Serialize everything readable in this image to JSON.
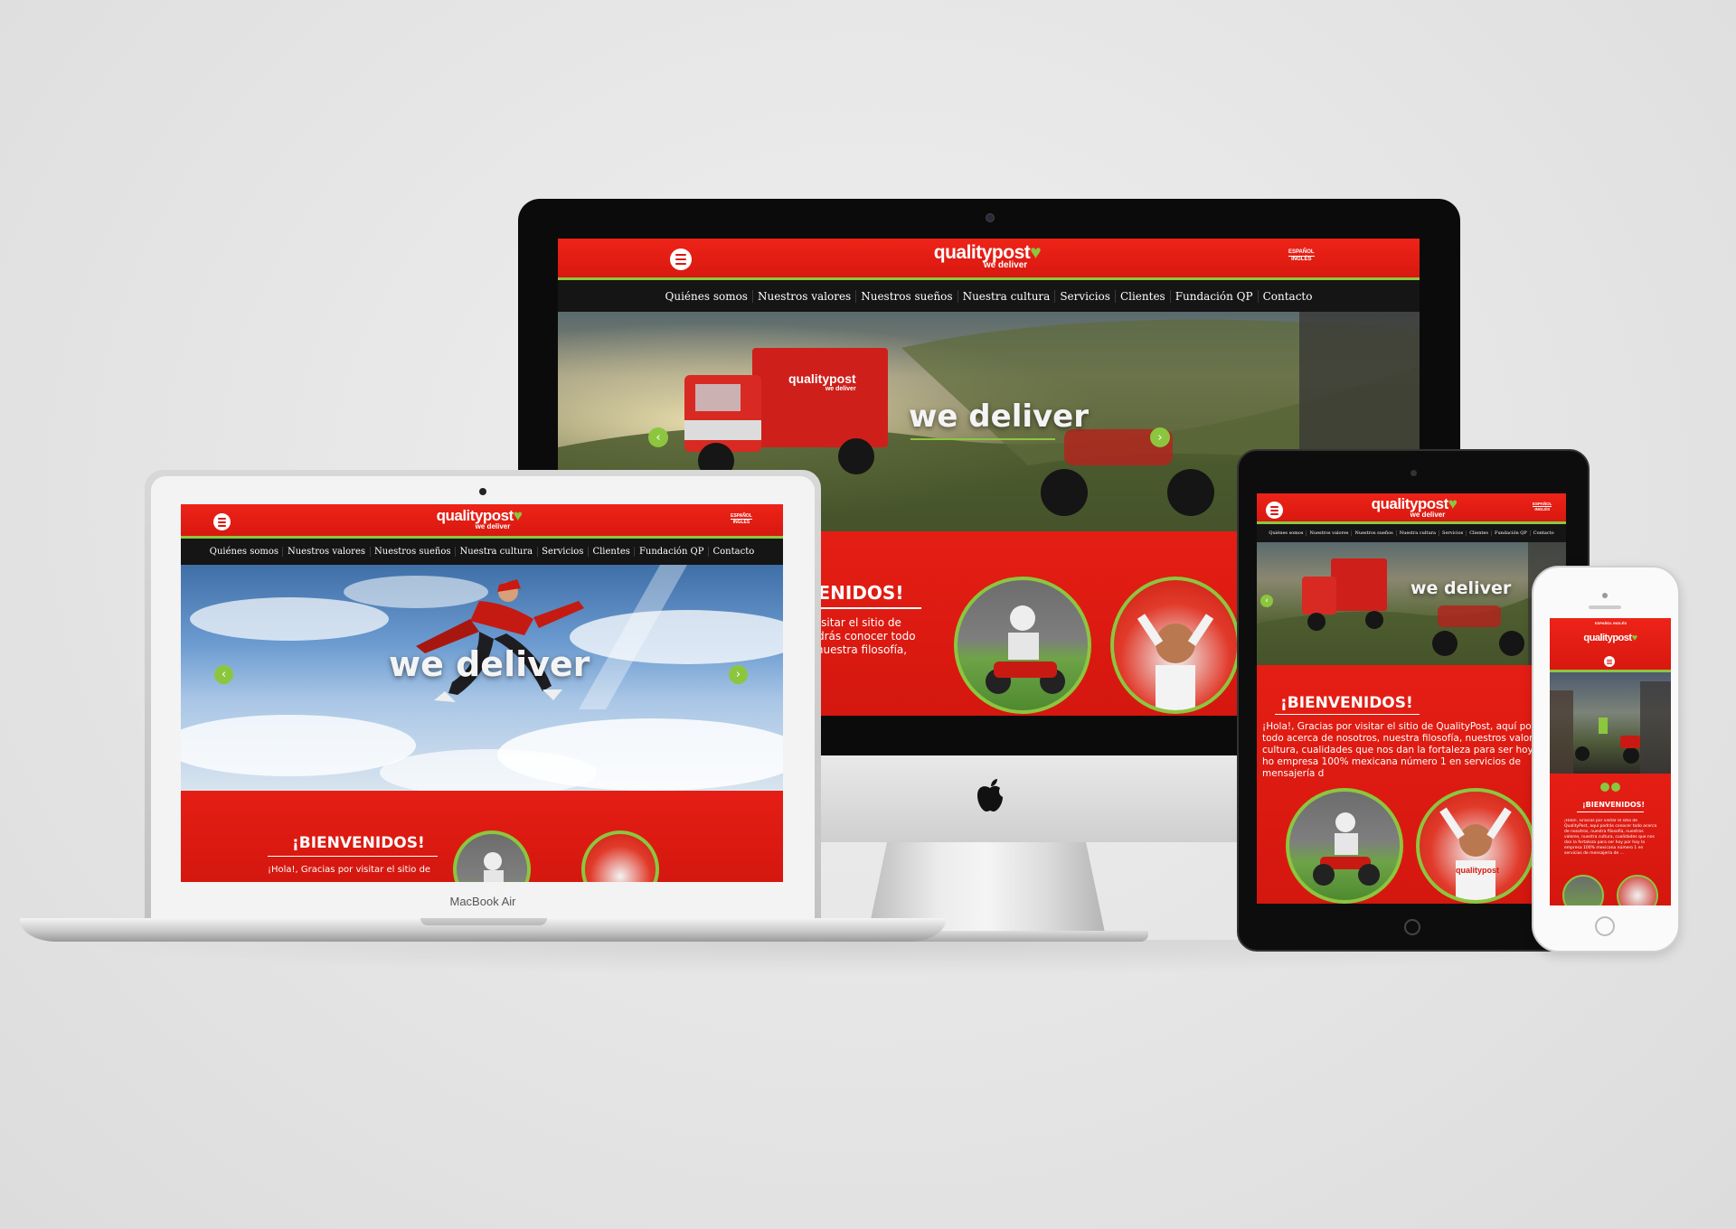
{
  "site": {
    "brand": "qualitypost",
    "tagline": "we deliver",
    "lang_es": "ESPAÑOL",
    "lang_en": "INGLÉS",
    "nav": [
      "Quiénes somos",
      "Nuestros valores",
      "Nuestros sueños",
      "Nuestra cultura",
      "Servicios",
      "Clientes",
      "Fundación QP",
      "Contacto"
    ],
    "hero_text": "we deliver",
    "welcome_title": "¡BIENVENIDOS!",
    "welcome_text": "¡Hola!, Gracias por visitar el sitio de QualityPost, aquí podrás conocer todo acerca de nosotros, nuestra filosofía, nuestros valores, nuestra cultura, cualidades que nos dan la fortaleza para ser hoy por hoy la empresa 100% mexicana número 1 en servicios de mensajería de ...",
    "truck_label": "qualitypost",
    "truck_tag": "we deliver",
    "badge_label": "qualitypost"
  },
  "imac": {
    "welcome_partial": "VENIDOS!",
    "text_line1": "r visitar el sitio de",
    "text_line2": "podrás conocer todo",
    "text_line3": "s, nuestra filosofía,"
  },
  "macbook": {
    "label": "MacBook Air",
    "text_line1": "¡Hola!, Gracias por visitar el sitio de"
  },
  "ipad": {
    "text": "¡Hola!, Gracias por visitar el sitio de QualityPost, aquí podrás c todo acerca de nosotros, nuestra filosofía, nuestros valores, nu cultura, cualidades que nos dan la fortaleza para ser hoy por ho empresa 100% mexicana número 1 en servicios de mensajería d"
  },
  "colors": {
    "brand_red": "#e51e14",
    "accent_green": "#8cc63f",
    "nav_dark": "#151515"
  },
  "icons": [
    "menu-icon",
    "heart-icon",
    "chevron-left-icon",
    "chevron-right-icon",
    "apple-logo-icon",
    "camera-icon",
    "home-button-icon"
  ]
}
